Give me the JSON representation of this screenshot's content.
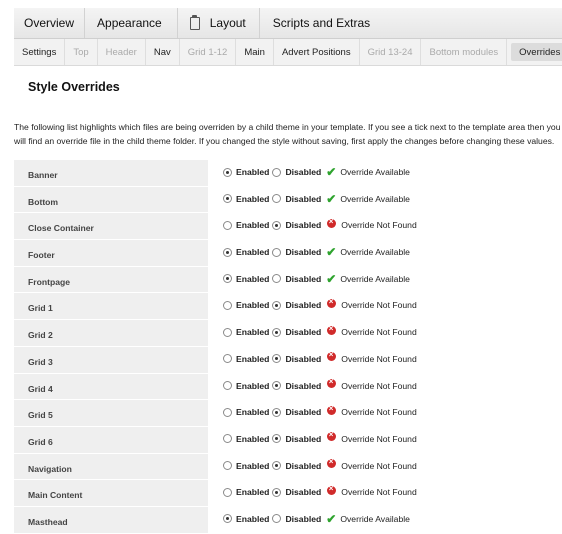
{
  "main_nav": [
    {
      "label": "Overview"
    },
    {
      "label": "Appearance"
    },
    {
      "label": "Layout",
      "icon": "clipboard-icon"
    },
    {
      "label": "Scripts and Extras"
    }
  ],
  "sub_nav": [
    {
      "label": "Settings",
      "state": "enabled"
    },
    {
      "label": "Top",
      "state": "disabled"
    },
    {
      "label": "Header",
      "state": "disabled"
    },
    {
      "label": "Nav",
      "state": "enabled"
    },
    {
      "label": "Grid 1-12",
      "state": "disabled"
    },
    {
      "label": "Main",
      "state": "enabled"
    },
    {
      "label": "Advert Positions",
      "state": "enabled"
    },
    {
      "label": "Grid 13-24",
      "state": "disabled"
    },
    {
      "label": "Bottom modules",
      "state": "disabled"
    },
    {
      "label": "Overrides",
      "state": "active"
    }
  ],
  "page": {
    "title": "Style Overrides",
    "description": "The following list highlights which files are being overriden by a child theme in your template. If you see a tick next to the template area then you will find an override file in the child theme folder. If you changed the style without saving, first apply the changes before changing these values.",
    "enabled_label": "Enabled",
    "disabled_label": "Disabled",
    "available_text": "Override Available",
    "not_found_text": "Override Not Found"
  },
  "rows": [
    {
      "name": "Banner",
      "enabled": true,
      "found": true
    },
    {
      "name": "Bottom",
      "enabled": true,
      "found": true
    },
    {
      "name": "Close Container",
      "enabled": false,
      "found": false
    },
    {
      "name": "Footer",
      "enabled": true,
      "found": true
    },
    {
      "name": "Frontpage",
      "enabled": true,
      "found": true
    },
    {
      "name": "Grid 1",
      "enabled": false,
      "found": false
    },
    {
      "name": "Grid 2",
      "enabled": false,
      "found": false
    },
    {
      "name": "Grid 3",
      "enabled": false,
      "found": false
    },
    {
      "name": "Grid 4",
      "enabled": false,
      "found": false
    },
    {
      "name": "Grid 5",
      "enabled": false,
      "found": false
    },
    {
      "name": "Grid 6",
      "enabled": false,
      "found": false
    },
    {
      "name": "Navigation",
      "enabled": false,
      "found": false
    },
    {
      "name": "Main Content",
      "enabled": false,
      "found": false
    },
    {
      "name": "Masthead",
      "enabled": true,
      "found": true
    }
  ],
  "colors": {
    "tick": "#2ea32e",
    "not_found": "#d02a2a",
    "label_bg": "#efefef"
  }
}
